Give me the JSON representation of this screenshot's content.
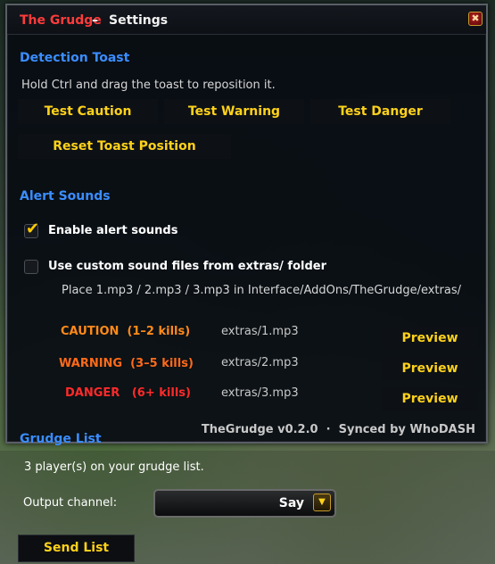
{
  "window": {
    "addon_name": "The Grudge",
    "separator": "–",
    "title": "Settings",
    "close_label": "✖"
  },
  "detection": {
    "heading": "Detection Toast",
    "hint": "Hold Ctrl and drag the toast to reposition it.",
    "test_caution": "Test Caution",
    "test_warning": "Test Warning",
    "test_danger": "Test Danger",
    "reset_position": "Reset Toast Position"
  },
  "alerts": {
    "heading": "Alert Sounds",
    "enable_label": "Enable alert sounds",
    "enable_checked": true,
    "custom_label": "Use custom sound files from extras/ folder",
    "custom_checked": false,
    "custom_hint": "Place 1.mp3 / 2.mp3 / 3.mp3 in Interface/AddOns/TheGrudge/extras/",
    "levels": [
      {
        "label": "CAUTION  (1–2 kills)",
        "file": "extras/1.mp3",
        "preview": "Preview",
        "color": "#ff8a1a"
      },
      {
        "label": "WARNING  (3–5 kills)",
        "file": "extras/2.mp3",
        "preview": "Preview",
        "color": "#ff6a1a"
      },
      {
        "label": "DANGER   (6+ kills)",
        "file": "extras/3.mp3",
        "preview": "Preview",
        "color": "#ff2a2a"
      }
    ]
  },
  "footer": {
    "version": "TheGrudge v0.2.0  ·  Synced by WhoDASH"
  },
  "grudge": {
    "heading": "Grudge List",
    "count_text": "3 player(s) on your grudge list.",
    "output_label": "Output channel:",
    "output_value": "Say",
    "send_label": "Send List"
  },
  "colors": {
    "accent_blue": "#3a8dff",
    "button_gold": "#ffd21a",
    "addon_red": "#ff3b3b"
  },
  "icons": {
    "close": "close-icon",
    "check": "checkmark-icon",
    "dropdown": "chevron-down-icon"
  }
}
